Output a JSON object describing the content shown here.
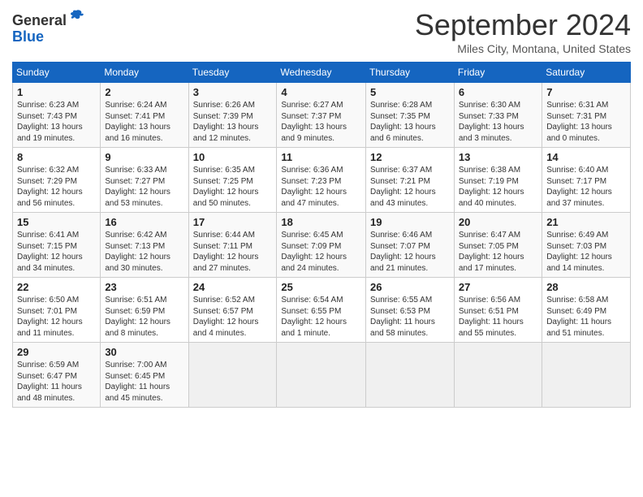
{
  "header": {
    "logo_general": "General",
    "logo_blue": "Blue",
    "month_title": "September 2024",
    "location": "Miles City, Montana, United States"
  },
  "weekdays": [
    "Sunday",
    "Monday",
    "Tuesday",
    "Wednesday",
    "Thursday",
    "Friday",
    "Saturday"
  ],
  "weeks": [
    [
      {
        "day": "1",
        "sunrise": "6:23 AM",
        "sunset": "7:43 PM",
        "daylight": "13 hours and 19 minutes."
      },
      {
        "day": "2",
        "sunrise": "6:24 AM",
        "sunset": "7:41 PM",
        "daylight": "13 hours and 16 minutes."
      },
      {
        "day": "3",
        "sunrise": "6:26 AM",
        "sunset": "7:39 PM",
        "daylight": "13 hours and 12 minutes."
      },
      {
        "day": "4",
        "sunrise": "6:27 AM",
        "sunset": "7:37 PM",
        "daylight": "13 hours and 9 minutes."
      },
      {
        "day": "5",
        "sunrise": "6:28 AM",
        "sunset": "7:35 PM",
        "daylight": "13 hours and 6 minutes."
      },
      {
        "day": "6",
        "sunrise": "6:30 AM",
        "sunset": "7:33 PM",
        "daylight": "13 hours and 3 minutes."
      },
      {
        "day": "7",
        "sunrise": "6:31 AM",
        "sunset": "7:31 PM",
        "daylight": "13 hours and 0 minutes."
      }
    ],
    [
      {
        "day": "8",
        "sunrise": "6:32 AM",
        "sunset": "7:29 PM",
        "daylight": "12 hours and 56 minutes."
      },
      {
        "day": "9",
        "sunrise": "6:33 AM",
        "sunset": "7:27 PM",
        "daylight": "12 hours and 53 minutes."
      },
      {
        "day": "10",
        "sunrise": "6:35 AM",
        "sunset": "7:25 PM",
        "daylight": "12 hours and 50 minutes."
      },
      {
        "day": "11",
        "sunrise": "6:36 AM",
        "sunset": "7:23 PM",
        "daylight": "12 hours and 47 minutes."
      },
      {
        "day": "12",
        "sunrise": "6:37 AM",
        "sunset": "7:21 PM",
        "daylight": "12 hours and 43 minutes."
      },
      {
        "day": "13",
        "sunrise": "6:38 AM",
        "sunset": "7:19 PM",
        "daylight": "12 hours and 40 minutes."
      },
      {
        "day": "14",
        "sunrise": "6:40 AM",
        "sunset": "7:17 PM",
        "daylight": "12 hours and 37 minutes."
      }
    ],
    [
      {
        "day": "15",
        "sunrise": "6:41 AM",
        "sunset": "7:15 PM",
        "daylight": "12 hours and 34 minutes."
      },
      {
        "day": "16",
        "sunrise": "6:42 AM",
        "sunset": "7:13 PM",
        "daylight": "12 hours and 30 minutes."
      },
      {
        "day": "17",
        "sunrise": "6:44 AM",
        "sunset": "7:11 PM",
        "daylight": "12 hours and 27 minutes."
      },
      {
        "day": "18",
        "sunrise": "6:45 AM",
        "sunset": "7:09 PM",
        "daylight": "12 hours and 24 minutes."
      },
      {
        "day": "19",
        "sunrise": "6:46 AM",
        "sunset": "7:07 PM",
        "daylight": "12 hours and 21 minutes."
      },
      {
        "day": "20",
        "sunrise": "6:47 AM",
        "sunset": "7:05 PM",
        "daylight": "12 hours and 17 minutes."
      },
      {
        "day": "21",
        "sunrise": "6:49 AM",
        "sunset": "7:03 PM",
        "daylight": "12 hours and 14 minutes."
      }
    ],
    [
      {
        "day": "22",
        "sunrise": "6:50 AM",
        "sunset": "7:01 PM",
        "daylight": "12 hours and 11 minutes."
      },
      {
        "day": "23",
        "sunrise": "6:51 AM",
        "sunset": "6:59 PM",
        "daylight": "12 hours and 8 minutes."
      },
      {
        "day": "24",
        "sunrise": "6:52 AM",
        "sunset": "6:57 PM",
        "daylight": "12 hours and 4 minutes."
      },
      {
        "day": "25",
        "sunrise": "6:54 AM",
        "sunset": "6:55 PM",
        "daylight": "12 hours and 1 minute."
      },
      {
        "day": "26",
        "sunrise": "6:55 AM",
        "sunset": "6:53 PM",
        "daylight": "11 hours and 58 minutes."
      },
      {
        "day": "27",
        "sunrise": "6:56 AM",
        "sunset": "6:51 PM",
        "daylight": "11 hours and 55 minutes."
      },
      {
        "day": "28",
        "sunrise": "6:58 AM",
        "sunset": "6:49 PM",
        "daylight": "11 hours and 51 minutes."
      }
    ],
    [
      {
        "day": "29",
        "sunrise": "6:59 AM",
        "sunset": "6:47 PM",
        "daylight": "11 hours and 48 minutes."
      },
      {
        "day": "30",
        "sunrise": "7:00 AM",
        "sunset": "6:45 PM",
        "daylight": "11 hours and 45 minutes."
      },
      null,
      null,
      null,
      null,
      null
    ]
  ]
}
